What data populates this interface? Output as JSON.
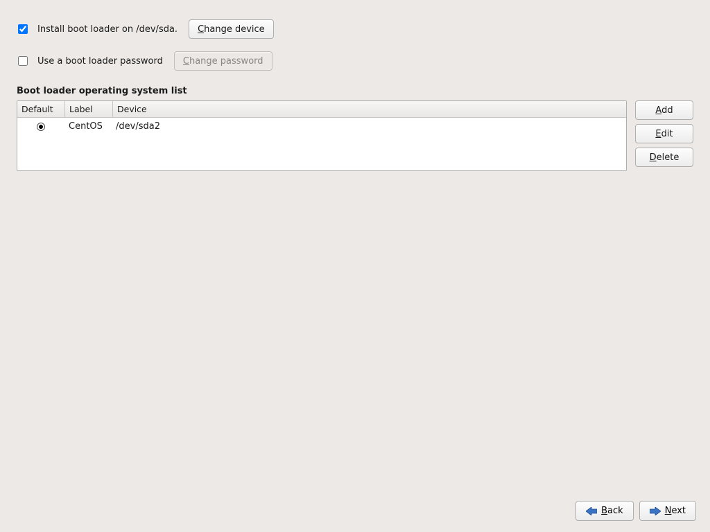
{
  "install": {
    "checked": true,
    "label": "Install boot loader on /dev/sda.",
    "change_device_label": "Change device"
  },
  "password": {
    "checked": false,
    "label": "Use a boot loader password",
    "change_password_label": "Change password"
  },
  "os_list": {
    "heading": "Boot loader operating system list",
    "columns": {
      "default": "Default",
      "label": "Label",
      "device": "Device"
    },
    "rows": [
      {
        "default": true,
        "label": "CentOS",
        "device": "/dev/sda2"
      }
    ],
    "buttons": {
      "add": "Add",
      "edit": "Edit",
      "delete": "Delete"
    }
  },
  "nav": {
    "back": "Back",
    "next": "Next"
  }
}
